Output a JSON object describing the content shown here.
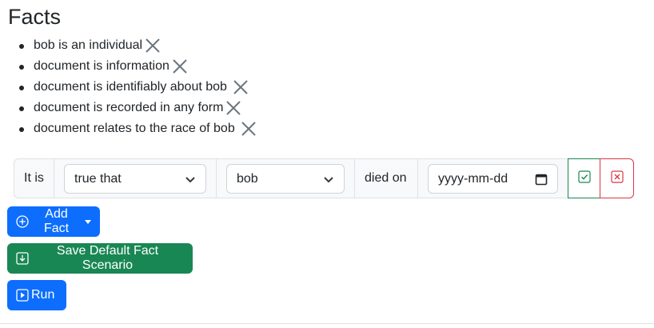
{
  "title": "Facts",
  "facts": [
    "bob is an individual",
    "document is information",
    "document is identifiably about bob",
    "document is recorded in any form",
    "document relates to the race of bob"
  ],
  "fact_form": {
    "prefix": "It is",
    "truth_select": "true that",
    "subject_select": "bob",
    "predicate": "died on",
    "date_placeholder": "yyyy-mm-dd"
  },
  "buttons": {
    "add_fact": "Add Fact",
    "save_default": "Save Default Fact Scenario",
    "run": "Run"
  },
  "colors": {
    "primary": "#0d6efd",
    "success": "#198754",
    "danger": "#dc3545"
  }
}
